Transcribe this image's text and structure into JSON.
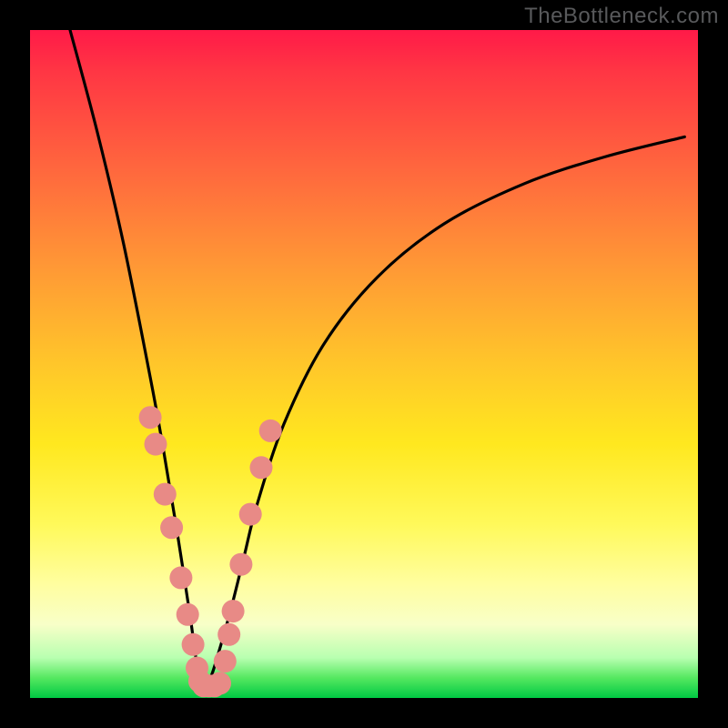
{
  "watermark": "TheBottleneck.com",
  "chart_data": {
    "type": "line",
    "title": "",
    "xlabel": "",
    "ylabel": "",
    "xlim": [
      0,
      100
    ],
    "ylim": [
      0,
      100
    ],
    "note": "Stylized bottleneck curve. Values are percentage coordinates within the plot area (0,0 = bottom-left). The curve shows a steep descent from top-left to a minimum near x≈26, then a concave-down rise toward the right edge reaching ~84% height.",
    "series": [
      {
        "name": "bottleneck-curve",
        "x": [
          6,
          10,
          14,
          18,
          20,
          22,
          24,
          25,
          26,
          27,
          28,
          30,
          32,
          34,
          38,
          44,
          52,
          62,
          74,
          86,
          98
        ],
        "y": [
          100,
          85,
          68,
          48,
          37,
          25,
          12,
          5,
          2,
          3,
          6,
          13,
          21,
          29,
          41,
          53,
          63,
          71,
          77,
          81,
          84
        ]
      }
    ],
    "markers": {
      "name": "data-points",
      "color": "#e88a86",
      "radius_pct": 1.7,
      "points": [
        {
          "x": 18.0,
          "y": 42.0
        },
        {
          "x": 18.8,
          "y": 38.0
        },
        {
          "x": 20.2,
          "y": 30.5
        },
        {
          "x": 21.2,
          "y": 25.5
        },
        {
          "x": 22.6,
          "y": 18.0
        },
        {
          "x": 23.6,
          "y": 12.5
        },
        {
          "x": 24.4,
          "y": 8.0
        },
        {
          "x": 25.0,
          "y": 4.5
        },
        {
          "x": 25.4,
          "y": 2.5
        },
        {
          "x": 26.0,
          "y": 1.8
        },
        {
          "x": 26.8,
          "y": 1.8
        },
        {
          "x": 27.6,
          "y": 1.8
        },
        {
          "x": 28.4,
          "y": 2.2
        },
        {
          "x": 29.2,
          "y": 5.5
        },
        {
          "x": 29.8,
          "y": 9.5
        },
        {
          "x": 30.4,
          "y": 13.0
        },
        {
          "x": 31.6,
          "y": 20.0
        },
        {
          "x": 33.0,
          "y": 27.5
        },
        {
          "x": 34.6,
          "y": 34.5
        },
        {
          "x": 36.0,
          "y": 40.0
        }
      ]
    }
  }
}
